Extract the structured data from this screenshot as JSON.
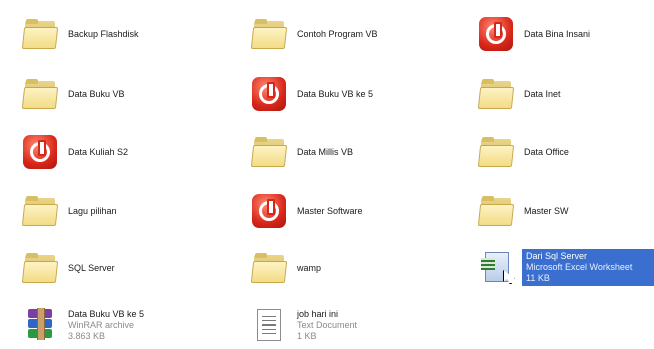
{
  "items": [
    {
      "label": "Backup Flashdisk",
      "icon": "folder-icon"
    },
    {
      "label": "Contoh Program VB",
      "icon": "folder-icon"
    },
    {
      "label": "Data Bina Insani",
      "icon": "app-icon"
    },
    {
      "label": "Data Buku VB",
      "icon": "folder-icon"
    },
    {
      "label": "Data Buku VB ke 5",
      "icon": "app-icon"
    },
    {
      "label": "Data Inet",
      "icon": "folder-icon"
    },
    {
      "label": "Data Kuliah S2",
      "icon": "app-icon"
    },
    {
      "label": "Data Millis VB",
      "icon": "folder-icon"
    },
    {
      "label": "Data Office",
      "icon": "folder-icon"
    },
    {
      "label": "Lagu pilihan",
      "icon": "folder-icon"
    },
    {
      "label": "Master Software",
      "icon": "app-icon"
    },
    {
      "label": "Master SW",
      "icon": "folder-icon"
    },
    {
      "label": "SQL Server",
      "icon": "folder-icon"
    },
    {
      "label": "wamp",
      "icon": "folder-icon"
    },
    {
      "label": "Dari Sql Server",
      "type": "Microsoft Excel Worksheet",
      "size": "11 KB",
      "icon": "excel-shortcut-icon",
      "selected": true
    },
    {
      "label": "Data Buku VB ke 5",
      "type": "WinRAR archive",
      "size": "3.863 KB",
      "icon": "winrar-icon"
    },
    {
      "label": "job hari ini",
      "type": "Text Document",
      "size": "1 KB",
      "icon": "text-document-icon"
    }
  ]
}
